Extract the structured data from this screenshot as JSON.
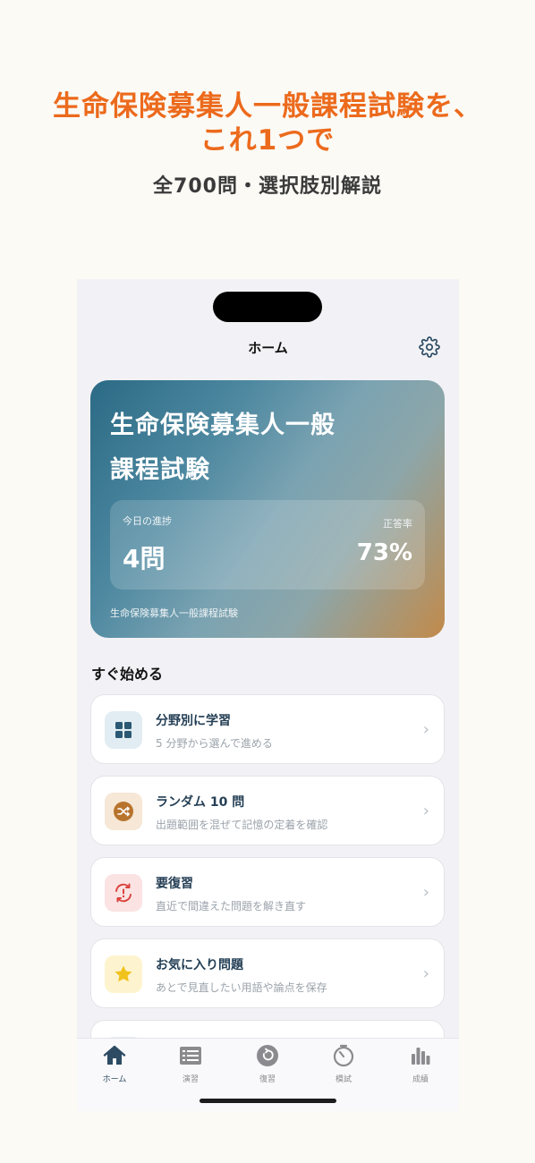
{
  "promo": {
    "headline_line1": "生命保険募集人一般課程試験を、",
    "headline_line2": "これ1つで",
    "subheadline": "全700問・選択肢別解説"
  },
  "screen": {
    "nav_title": "ホーム",
    "hero": {
      "title_line1": "生命保険募集人一般",
      "title_line2": "課程試験",
      "progress_label": "今日の進捗",
      "progress_value": "4問",
      "accuracy_label": "正答率",
      "accuracy_value": "73%",
      "footer": "生命保険募集人一般課程試験"
    },
    "section_title": "すぐ始める",
    "actions": [
      {
        "title": "分野別に学習",
        "subtitle": "5 分野から選んで進める",
        "icon": "grid-icon",
        "icon_bg": "#e2edf3",
        "icon_color": "#2b5873"
      },
      {
        "title": "ランダム 10 問",
        "subtitle": "出題範囲を混ぜて記憶の定着を確認",
        "icon": "shuffle-icon",
        "icon_bg": "#f6e7d6",
        "icon_color": "#b8742d"
      },
      {
        "title": "要復習",
        "subtitle": "直近で間違えた問題を解き直す",
        "icon": "review-alert-icon",
        "icon_bg": "#fbe3e3",
        "icon_color": "#d9433d"
      },
      {
        "title": "お気に入り問題",
        "subtitle": "あとで見直したい用語や論点を保存",
        "icon": "star-icon",
        "icon_bg": "#fdf4cf",
        "icon_color": "#f1c21b"
      }
    ],
    "tabs": [
      {
        "label": "ホーム",
        "icon": "home-icon",
        "active": true
      },
      {
        "label": "演習",
        "icon": "list-icon",
        "active": false
      },
      {
        "label": "復習",
        "icon": "review-icon",
        "active": false
      },
      {
        "label": "模試",
        "icon": "timer-icon",
        "active": false
      },
      {
        "label": "成績",
        "icon": "bar-chart-icon",
        "active": false
      }
    ],
    "colors": {
      "accent_orange": "#ec6a1c",
      "primary_navy": "#2d4b63",
      "tab_inactive": "#8b8b8f"
    }
  }
}
